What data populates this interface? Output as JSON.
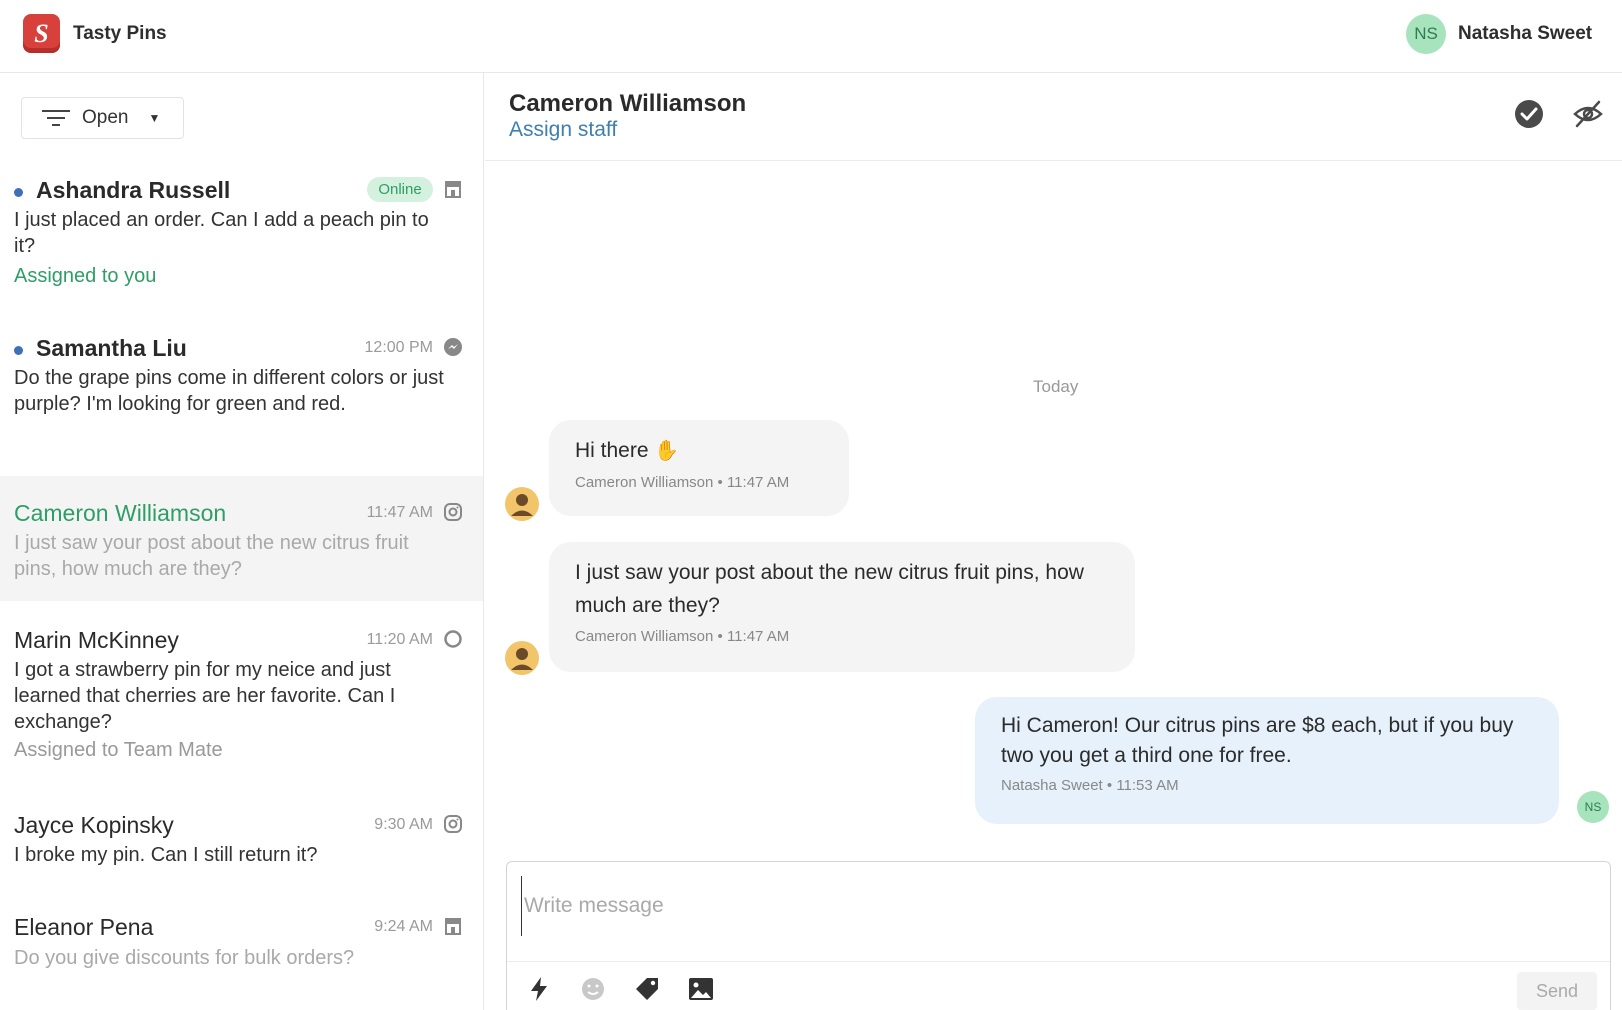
{
  "app": {
    "name": "Tasty Pins",
    "logo_letter": "S"
  },
  "user": {
    "initials": "NS",
    "name": "Natasha Sweet"
  },
  "filter": {
    "label": "Open"
  },
  "conversations": [
    {
      "name": "Ashandra Russell",
      "badge": "Online",
      "snippet": "I just placed an order. Can I add a peach pin to it?",
      "assigned": "Assigned to you",
      "channel": "store-icon",
      "unread": true
    },
    {
      "name": "Samantha Liu",
      "time": "12:00 PM",
      "snippet": "Do the grape pins come in different colors or just purple? I'm looking for green and red.",
      "channel": "messenger-icon",
      "unread": true
    },
    {
      "name": "Cameron Williamson",
      "time": "11:47 AM",
      "snippet": "I just saw your post about the new citrus fruit pins, how much are they?",
      "channel": "instagram-icon",
      "active": true
    },
    {
      "name": "Marin McKinney",
      "time": "11:20 AM",
      "snippet": "I got a strawberry pin for my neice and just learned that cherries are her favorite. Can I exchange?",
      "assigned": "Assigned to Team Mate",
      "channel": "whatsapp-icon"
    },
    {
      "name": "Jayce Kopinsky",
      "time": "9:30 AM",
      "snippet": "I broke my pin. Can I still return it?",
      "channel": "instagram-icon"
    },
    {
      "name": "Eleanor Pena",
      "time": "9:24 AM",
      "snippet": "Do you give discounts for bulk orders?",
      "channel": "store-icon"
    }
  ],
  "chat": {
    "title": "Cameron Williamson",
    "assign_label": "Assign staff",
    "day_label": "Today",
    "messages": [
      {
        "text": "Hi there",
        "meta": "Cameron Williamson • 11:47 AM"
      },
      {
        "text": "I just saw your post about the new citrus fruit pins, how much are they?",
        "meta": "Cameron Williamson • 11:47 AM"
      },
      {
        "text": "Hi Cameron! Our citrus pins are $8 each, but if you buy two you get a third one for free.",
        "meta": "Natasha Sweet • 11:53 AM"
      }
    ]
  },
  "composer": {
    "placeholder": "Write message",
    "send_label": "Send"
  },
  "colors": {
    "brand": "#d8403c",
    "accent": "#2e9e66",
    "link": "#3f7fb0",
    "unread_dot": "#3f6fb4",
    "agent_bubble": "#e6f1fb"
  }
}
